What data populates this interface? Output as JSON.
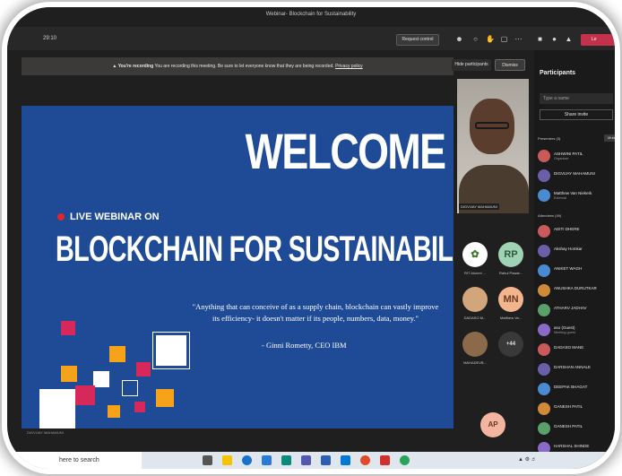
{
  "window": {
    "title": "Webinar- Blockchain for Sustainability"
  },
  "toolbar": {
    "timer": "29:10",
    "request_control": "Request control",
    "leave_label": "Le",
    "icons": [
      "people-icon",
      "chat-icon",
      "raise-hand-icon",
      "rooms-icon",
      "more-icon",
      "camera-icon",
      "mic-icon",
      "share-icon"
    ]
  },
  "banner": {
    "bold": "You're recording",
    "text": "You are recording this meeting. Be sure to let everyone know that they are being recorded.",
    "link": "Privacy policy"
  },
  "video_toggles": {
    "hide": "Hide participants",
    "dismiss": "Dismiss"
  },
  "slide": {
    "welcome": "WELCOME",
    "live": "LIVE WEBINAR ON",
    "headline": "BLOCKCHAIN FOR SUSTAINABILITY",
    "quote": "\"Anything that can conceive of as a supply chain, blockchain can vastly improve its efficiency- it doesn't matter if its people, numbers, data, money.\"",
    "attribution": "- Ginni Rometty, CEO IBM",
    "footer_name": "DIGVIJAY MAHAMUNI"
  },
  "videos": {
    "main_name": "DIGVIJAY MAHAMUNI",
    "tiles": [
      {
        "initials": "",
        "label": "RIT Alumni ...",
        "color": "#ffffff"
      },
      {
        "initials": "RP",
        "label": "Rahul Pawar...",
        "color": "#9fd3b4"
      },
      {
        "initials": "",
        "label": "DADASO M...",
        "color": "#d2a57a"
      },
      {
        "initials": "MN",
        "label": "Matthew Va...",
        "color": "#f2b58e"
      },
      {
        "initials": "",
        "label": "MAHADEVB...",
        "color": "#8a6a4a"
      },
      {
        "initials": "+44",
        "label": "",
        "color": "#3a3939"
      },
      {
        "initials": "AP",
        "label": "",
        "color": "#f3b5a0"
      }
    ]
  },
  "participants": {
    "title": "Participants",
    "search_placeholder": "Type a name",
    "share_invite": "Share invite",
    "presenters_header": "Presenters (3)",
    "mute_all": "Mute all",
    "presenters": [
      {
        "name": "ASHWINI PATIL",
        "role": "Organizer"
      },
      {
        "name": "DIGVIJAY MAHAMUNI",
        "role": ""
      },
      {
        "name": "Matthew Van Niekerk",
        "role": "External"
      }
    ],
    "attendees_header": "Attendees (49)",
    "attendees": [
      {
        "name": "ADITI DHERE",
        "role": ""
      },
      {
        "name": "Akshay Homkar",
        "role": ""
      },
      {
        "name": "ANIKET WAGH",
        "role": ""
      },
      {
        "name": "ANUSHKA DURUTKAR",
        "role": ""
      },
      {
        "name": "ATHARV JADHAV",
        "role": ""
      },
      {
        "name": "aso (Guest)",
        "role": "Meeting guest"
      },
      {
        "name": "DADASO MANE",
        "role": ""
      },
      {
        "name": "DARSHAN ANNALE",
        "role": ""
      },
      {
        "name": "DEEPAK BHAGAT",
        "role": ""
      },
      {
        "name": "GANESH PATIL",
        "role": ""
      },
      {
        "name": "GANESH PATIL",
        "role": ""
      },
      {
        "name": "HARSHAL SHINDE",
        "role": ""
      }
    ]
  },
  "taskbar": {
    "search": "here to search"
  },
  "colors": {
    "slide_blue": "#1f4b96",
    "leave_red": "#c4314b",
    "accent_orange": "#f7a21b",
    "accent_magenta": "#d6285a"
  }
}
